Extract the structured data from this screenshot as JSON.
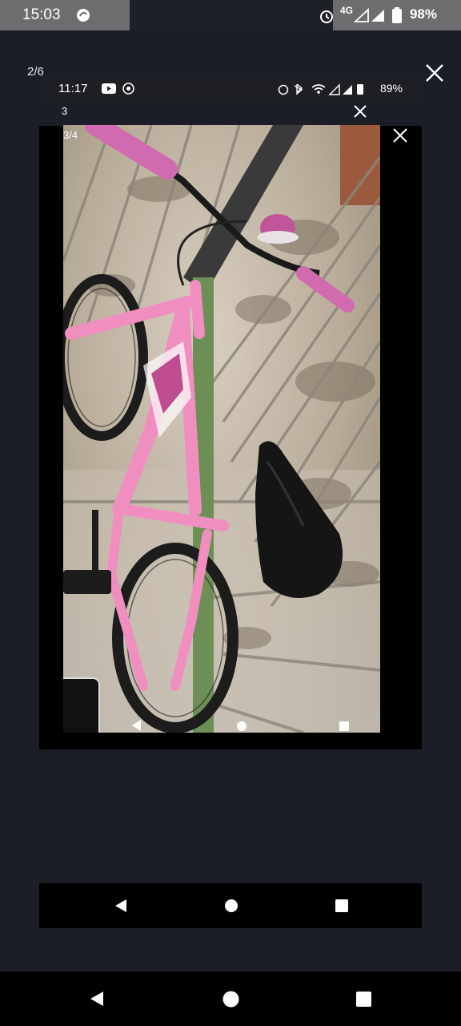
{
  "status_bar": {
    "time": "15:03",
    "network": "4G",
    "battery": "98%"
  },
  "viewer": {
    "counter": "2/6"
  },
  "inner_screenshot": {
    "status_time": "11:17",
    "battery": "89%",
    "toolbar_counter": "3",
    "photo_counter": "3/4"
  },
  "colors": {
    "background": "#1b1e26",
    "bike_pink": "#f08fbf",
    "status_bar": "#6d6d70"
  }
}
